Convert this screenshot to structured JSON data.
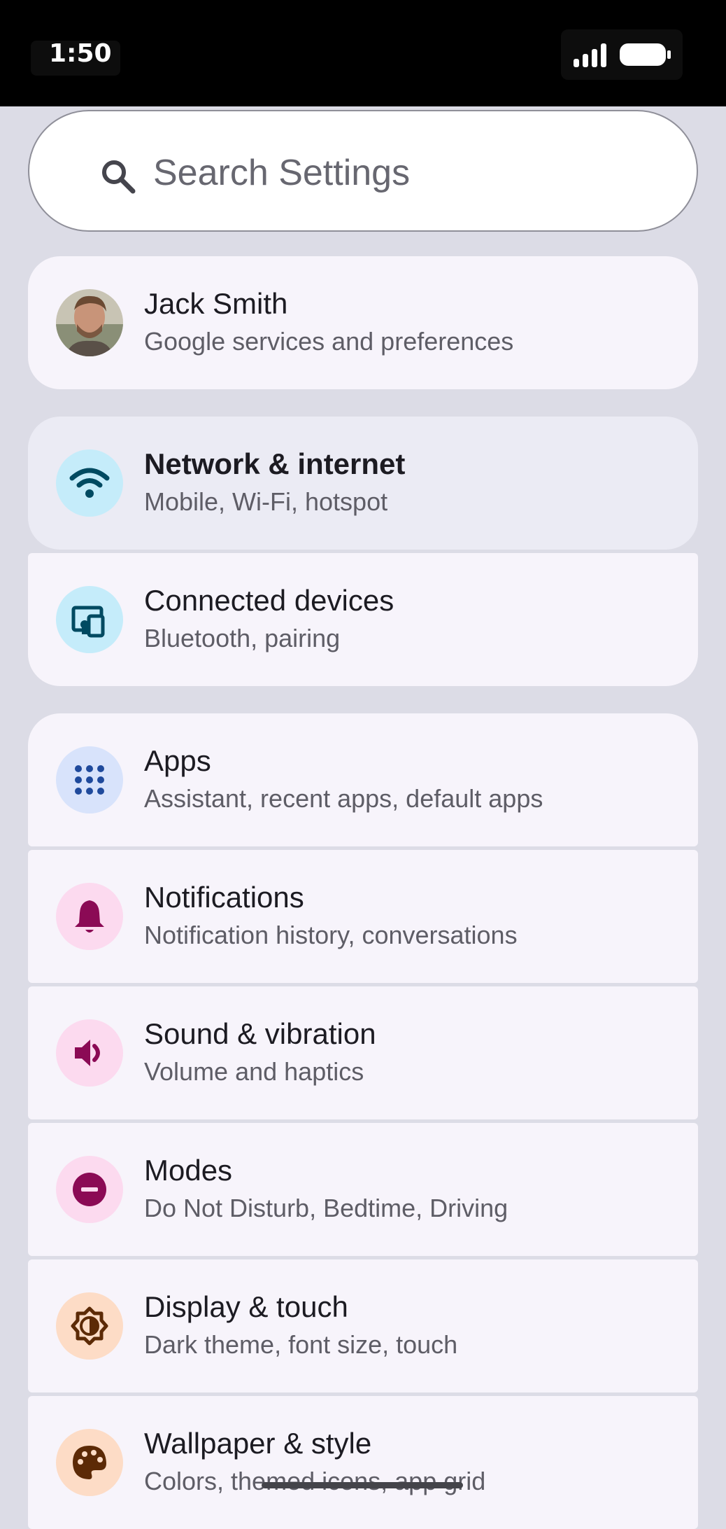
{
  "status_bar": {
    "time": "1:50",
    "icons": [
      "signal-icon",
      "battery-icon"
    ]
  },
  "search": {
    "placeholder": "Search Settings",
    "icon": "search-icon"
  },
  "account": {
    "name": "Jack Smith",
    "subtitle": "Google services and preferences",
    "icon": "avatar"
  },
  "items": [
    {
      "title": "Network & internet",
      "subtitle": "Mobile, Wi-Fi, hotspot",
      "icon": "wifi-icon",
      "icon_bg": "#c5ecfa",
      "icon_color": "#004a61"
    },
    {
      "title": "Connected devices",
      "subtitle": "Bluetooth, pairing",
      "icon": "connected-devices-icon",
      "icon_bg": "#c5ecfa",
      "icon_color": "#004a61"
    },
    {
      "title": "Apps",
      "subtitle": "Assistant, recent apps, default apps",
      "icon": "apps-grid-icon",
      "icon_bg": "#d8e3fb",
      "icon_color": "#1f4a9c"
    },
    {
      "title": "Notifications",
      "subtitle": "Notification history, conversations",
      "icon": "bell-icon",
      "icon_bg": "#fcdaef",
      "icon_color": "#8b0a55"
    },
    {
      "title": "Sound & vibration",
      "subtitle": "Volume and haptics",
      "icon": "speaker-icon",
      "icon_bg": "#fcdaef",
      "icon_color": "#8b0a55"
    },
    {
      "title": "Modes",
      "subtitle": "Do Not Disturb, Bedtime, Driving",
      "icon": "do-not-disturb-icon",
      "icon_bg": "#fcdaef",
      "icon_color": "#8b0a55"
    },
    {
      "title": "Display & touch",
      "subtitle": "Dark theme, font size, touch",
      "icon": "brightness-icon",
      "icon_bg": "#fddcc6",
      "icon_color": "#5c2a06"
    },
    {
      "title": "Wallpaper & style",
      "subtitle": "Colors, themed icons, app grid",
      "icon": "palette-icon",
      "icon_bg": "#fddcc6",
      "icon_color": "#5c2a06"
    }
  ],
  "selected_item": "Network & internet"
}
